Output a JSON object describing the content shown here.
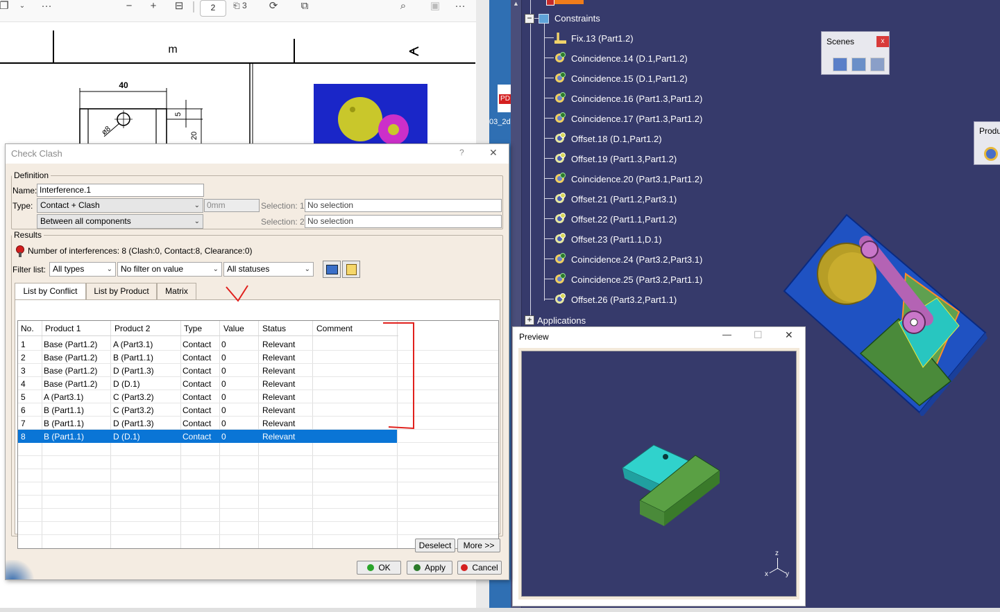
{
  "pdf_viewer": {
    "page_number": "2",
    "page_total": "3",
    "dim_40": "40",
    "dim_5": "5",
    "dim_phi8": "ø8",
    "dim_20": "20",
    "dim_m": "m",
    "desktop_file_label": "PD",
    "desktop_file_name": "03_2d"
  },
  "tree": {
    "constraints_label": "Constraints",
    "applications_label": "Applications",
    "items": [
      {
        "label": "Fix.13  (Part1.2)",
        "icon": "fix-icon"
      },
      {
        "label": "Coincidence.14  (D.1,Part1.2)",
        "icon": "coincidence-icon"
      },
      {
        "label": "Coincidence.15  (D.1,Part1.2)",
        "icon": "coincidence-icon"
      },
      {
        "label": "Coincidence.16  (Part1.3,Part1.2)",
        "icon": "coincidence-icon"
      },
      {
        "label": "Coincidence.17  (Part1.3,Part1.2)",
        "icon": "coincidence-icon"
      },
      {
        "label": "Offset.18  (D.1,Part1.2)",
        "icon": "offset-icon"
      },
      {
        "label": "Offset.19  (Part1.3,Part1.2)",
        "icon": "offset-icon"
      },
      {
        "label": "Coincidence.20  (Part3.1,Part1.2)",
        "icon": "coincidence-icon"
      },
      {
        "label": "Offset.21  (Part1.2,Part3.1)",
        "icon": "offset-icon"
      },
      {
        "label": "Offset.22  (Part1.1,Part1.2)",
        "icon": "offset-icon"
      },
      {
        "label": "Offset.23  (Part1.1,D.1)",
        "icon": "offset-icon"
      },
      {
        "label": "Coincidence.24  (Part3.2,Part3.1)",
        "icon": "coincidence-icon"
      },
      {
        "label": "Coincidence.25  (Part3.2,Part1.1)",
        "icon": "coincidence-icon"
      },
      {
        "label": "Offset.26  (Part3.2,Part1.1)",
        "icon": "offset-icon"
      }
    ]
  },
  "scenes_panel": {
    "title": "Scenes",
    "close": "x"
  },
  "product_panel": {
    "title": "Produ"
  },
  "dialog": {
    "title": "Check Clash",
    "help": "?",
    "close": "✕",
    "definition": {
      "legend": "Definition",
      "name_label": "Name:",
      "name_value": "Interference.1",
      "type_label": "Type:",
      "type_value": "Contact + Clash",
      "clearance_value": "0mm",
      "scope_value": "Between all components",
      "selection1_label": "Selection: 1",
      "selection1_value": "No selection",
      "selection2_label": "Selection: 2",
      "selection2_value": "No selection"
    },
    "results": {
      "legend": "Results",
      "summary": "Number of interferences: 8 (Clash:0, Contact:8, Clearance:0)",
      "filter_label": "Filter list:",
      "filter_types": "All types",
      "filter_value": "No filter on value",
      "filter_status": "All statuses"
    },
    "tabs": [
      "List by Conflict",
      "List by Product",
      "Matrix"
    ],
    "columns": [
      "No.",
      "Product 1",
      "Product 2",
      "Type",
      "Value",
      "Status",
      "Comment"
    ],
    "rows": [
      [
        "1",
        "Base (Part1.2)",
        "A (Part3.1)",
        "Contact",
        "0",
        "Relevant",
        ""
      ],
      [
        "2",
        "Base (Part1.2)",
        "B (Part1.1)",
        "Contact",
        "0",
        "Relevant",
        ""
      ],
      [
        "3",
        "Base (Part1.2)",
        "D (Part1.3)",
        "Contact",
        "0",
        "Relevant",
        ""
      ],
      [
        "4",
        "Base (Part1.2)",
        "D (D.1)",
        "Contact",
        "0",
        "Relevant",
        ""
      ],
      [
        "5",
        "A (Part3.1)",
        "C (Part3.2)",
        "Contact",
        "0",
        "Relevant",
        ""
      ],
      [
        "6",
        "B (Part1.1)",
        "C (Part3.2)",
        "Contact",
        "0",
        "Relevant",
        ""
      ],
      [
        "7",
        "B (Part1.1)",
        "D (Part1.3)",
        "Contact",
        "0",
        "Relevant",
        ""
      ],
      [
        "8",
        "B (Part1.1)",
        "D (D.1)",
        "Contact",
        "0",
        "Relevant",
        ""
      ]
    ],
    "selected_row": 8,
    "buttons": {
      "deselect": "Deselect",
      "more": "More >>",
      "ok": "OK",
      "apply": "Apply",
      "cancel": "Cancel"
    }
  },
  "preview": {
    "title": "Preview",
    "minimize": "—",
    "maximize": "☐",
    "close": "✕",
    "axis_z": "z",
    "axis_x": "x",
    "axis_y": "y"
  },
  "colors": {
    "catia_bg": "#363a6b",
    "selection": "#0a75d6",
    "annotation_red": "#e0201c",
    "ok_green": "#2aa52a",
    "cancel_red": "#d42020"
  }
}
